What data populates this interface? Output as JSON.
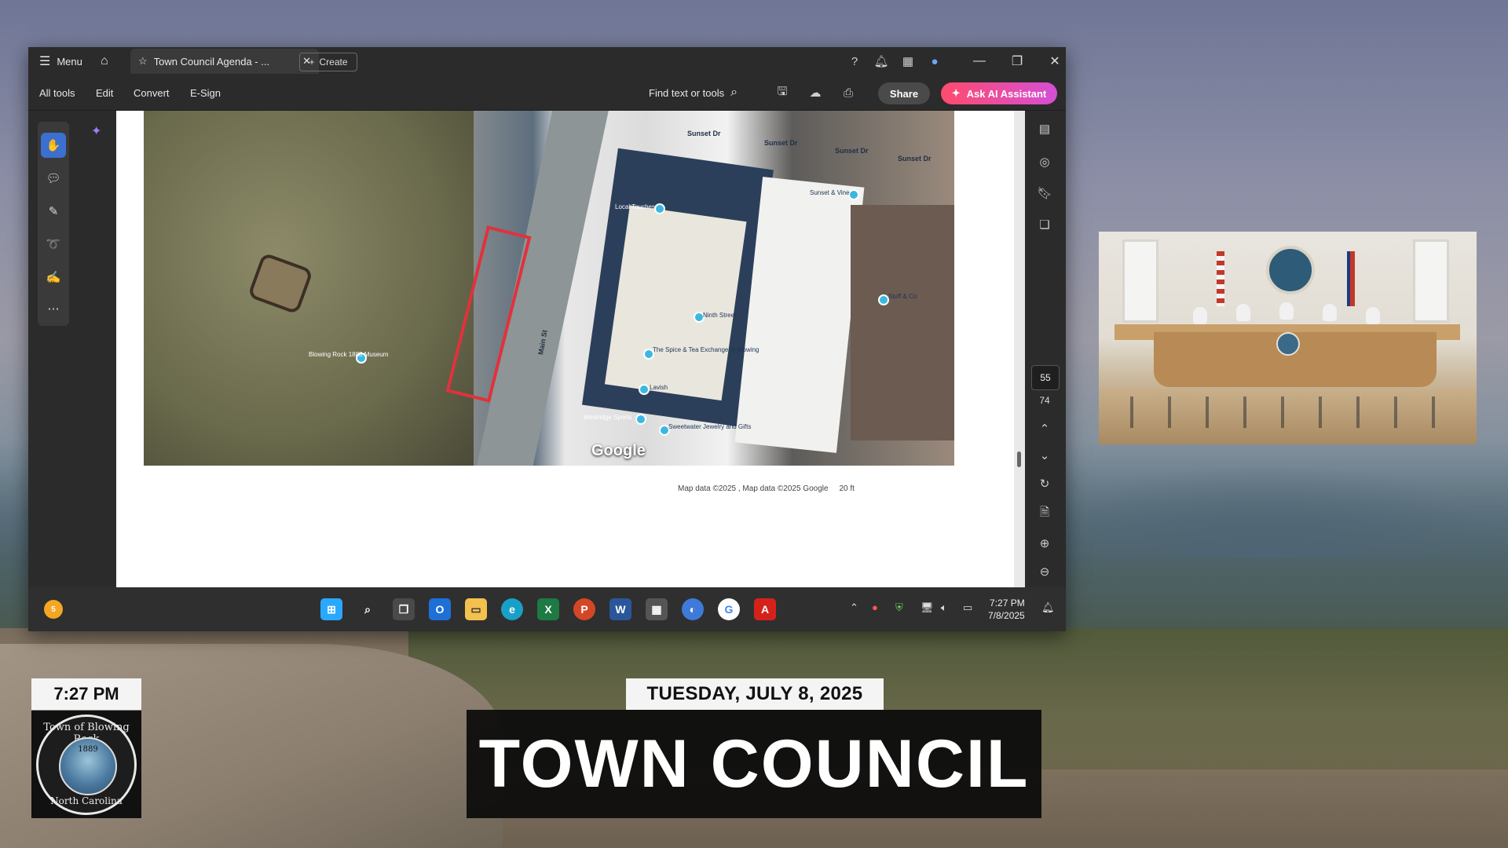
{
  "window": {
    "menu_label": "Menu",
    "tab_title": "Town Council Agenda - ...",
    "create_label": "Create"
  },
  "toolbar": {
    "all_tools": "All tools",
    "edit": "Edit",
    "convert": "Convert",
    "esign": "E-Sign",
    "find_text": "Find text or tools",
    "share": "Share",
    "ask_ai": "Ask AI Assistant"
  },
  "document": {
    "map": {
      "google_mark": "Google",
      "attribution": "Map data ©2025 , Map data ©2025 Google",
      "scale": "20 ft",
      "streets": [
        "Sunset Dr",
        "Sunset Dr",
        "Sunset Dr",
        "Sunset Dr",
        "Main St"
      ],
      "places": [
        "Local Touches",
        "Sunset & Vine",
        "Blowing Rock 1888 Museum",
        "The Spice & Tea Exchange of Blowing",
        "Lavish",
        "Westridge Sports",
        "Sweetwater Jewelry and Gifts",
        "Ninth Street",
        "Stuff & Co"
      ]
    }
  },
  "page_nav": {
    "current_page": "55",
    "total_pages": "74"
  },
  "taskbar": {
    "time": "7:27 PM",
    "date": "7/8/2025",
    "notification_count": "5"
  },
  "overlay": {
    "time": "7:27 PM",
    "date": "TUESDAY, JULY 8, 2025",
    "title": "TOWN COUNCIL",
    "logo_top": "Town of Blowing Rock",
    "logo_year": "1889",
    "logo_bottom": "North Carolina"
  },
  "colors": {
    "app_bg": "#2b2b2b",
    "accent_blue": "#3b6fd0",
    "ai_gradient_start": "#ff4b6e",
    "ai_gradient_end": "#d44fd6",
    "map_outline": "#e0323c"
  }
}
